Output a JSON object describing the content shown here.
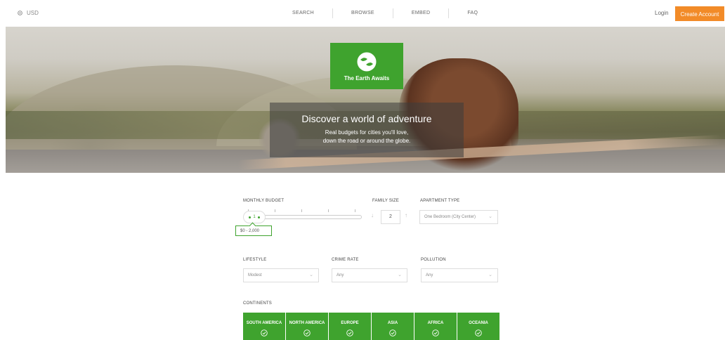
{
  "nav": {
    "currency": "USD",
    "links": [
      "SEARCH",
      "BROWSE",
      "EMBED",
      "FAQ"
    ],
    "login": "Login",
    "create_account": "Create Account"
  },
  "hero": {
    "brand": "The Earth Awaits",
    "headline": "Discover a world of adventure",
    "subline1": "Real budgets for cities you'll love,",
    "subline2": "down the road or around the globe."
  },
  "form": {
    "monthly_budget_label": "MONTHLY BUDGET",
    "budget_handle_value": "1",
    "budget_range": "$0 - 2,000",
    "family_size_label": "FAMILY SIZE",
    "family_size_value": "2",
    "apartment_type_label": "APARTMENT TYPE",
    "apartment_type_value": "One Bedroom (City Center)",
    "lifestyle_label": "LIFESTYLE",
    "lifestyle_value": "Modest",
    "crime_rate_label": "CRIME RATE",
    "crime_rate_value": "Any",
    "pollution_label": "POLLUTION",
    "pollution_value": "Any",
    "continents_label": "CONTINENTS",
    "continents": [
      "SOUTH AMERICA",
      "NORTH AMERICA",
      "EUROPE",
      "ASIA",
      "AFRICA",
      "OCEANIA"
    ]
  },
  "colors": {
    "accent_green": "#3fa32e",
    "accent_orange": "#f28b28"
  }
}
